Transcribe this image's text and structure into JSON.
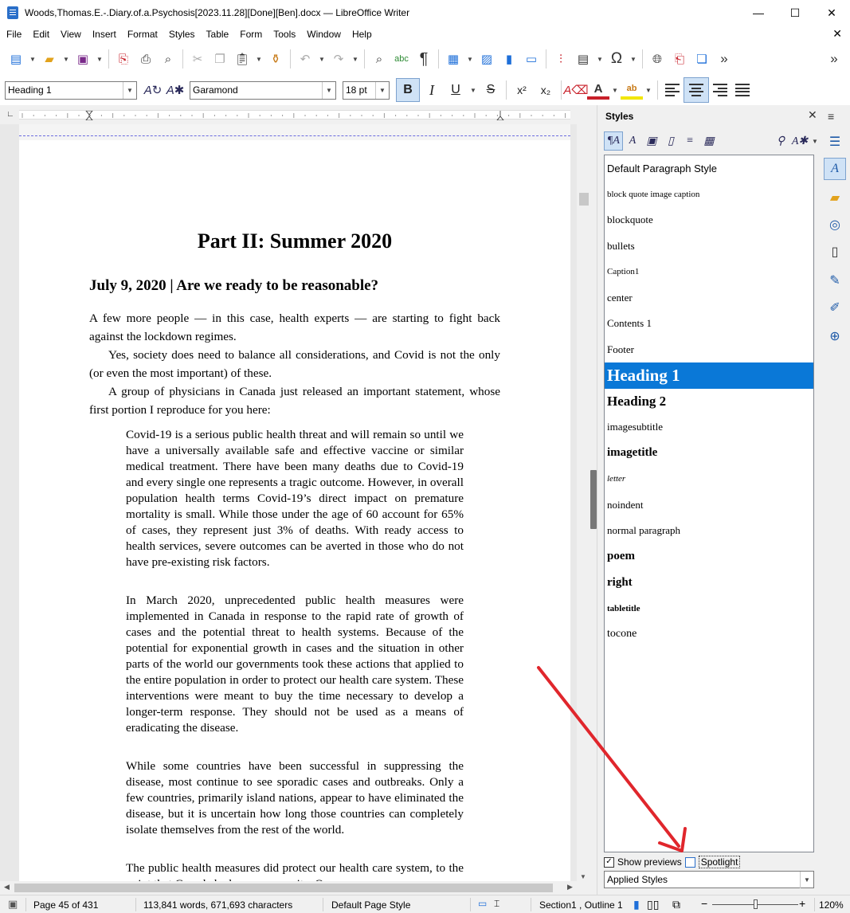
{
  "window": {
    "title": "Woods,Thomas.E.-.Diary.of.a.Psychosis[2023.11.28][Done][Ben].docx — LibreOffice Writer",
    "minimize": "—",
    "maximize": "☐",
    "close": "✕"
  },
  "menu": {
    "items": [
      "File",
      "Edit",
      "View",
      "Insert",
      "Format",
      "Styles",
      "Table",
      "Form",
      "Tools",
      "Window",
      "Help"
    ],
    "close_doc": "✕"
  },
  "formatting": {
    "paragraph_style": "Heading 1",
    "font_name": "Garamond",
    "font_size": "18 pt",
    "bold": "B",
    "italic": "I",
    "underline": "U",
    "strike": "S",
    "superscript": "x²",
    "subscript": "x₂"
  },
  "document": {
    "part_title": "Part II: Summer 2020",
    "entry_heading": "July 9, 2020  |  Are we ready to be reasonable?",
    "paragraphs": [
      "A few more people — in this case, health experts — are starting to fight back against the lockdown regimes.",
      "Yes, society does need to balance all considerations, and Covid is not the only (or even the most important) of these.",
      "A group of physicians in Canada just released an important statement, whose first portion I reproduce for you here:"
    ],
    "blockquotes": [
      "Covid-19 is a serious public health threat and will remain so until we have a universally available safe and effective vaccine or similar medical treatment. There have been many deaths due to Covid-19 and every single one represents a tragic outcome. However, in overall population health terms Covid-19’s direct impact on premature mortality is small. While those under the age of 60 account for 65% of cases, they represent just 3% of deaths. With ready access to health services, severe outcomes can be averted in those who do not have pre-existing risk factors.",
      "In March 2020, unprecedented public health measures were implemented in Canada in response to the rapid rate of growth of cases and the potential threat to health systems. Because of the potential for exponential growth in cases and the situation in other parts of the world our governments took these actions that applied to the entire population in order to protect our health care system. These interventions were meant to buy the time necessary to develop a longer-term response. They should not be used as a means of eradicating the disease.",
      "While some countries have been successful in suppressing the disease, most continue to see sporadic cases and outbreaks. Only a few countries, primarily island nations, appear to have eliminated the disease, but it is uncertain how long those countries can completely isolate themselves from the rest of the world.",
      "The public health measures did protect our health care system, to the point that Canada had excess capacity. Our"
    ]
  },
  "sidebar": {
    "title": "Styles",
    "close": "✕",
    "styles": [
      "Default Paragraph Style",
      "block quote image caption",
      "blockquote",
      "bullets",
      "Caption1",
      "center",
      "Contents 1",
      "Footer",
      "Heading 1",
      "Heading 2",
      "imagesubtitle",
      "imagetitle",
      "letter",
      "noindent",
      "normal paragraph",
      "poem",
      "right",
      "tabletitle",
      "tocone"
    ],
    "selected_style": "Heading 1",
    "show_previews_label": "Show previews",
    "show_previews_checked": true,
    "spotlight_label": "Spotlight",
    "spotlight_checked": false,
    "filter_value": "Applied Styles"
  },
  "statusbar": {
    "page": "Page 45 of 431",
    "word_count": "113,841 words, 671,693 characters",
    "page_style": "Default Page Style",
    "outline": "Section1 , Outline 1",
    "zoom": "120%",
    "zoom_minus": "−",
    "zoom_plus": "+"
  },
  "colors": {
    "selection": "#0a78d7",
    "annotation_arrow": "#e0262c",
    "active_button": "#cfe2f6"
  }
}
